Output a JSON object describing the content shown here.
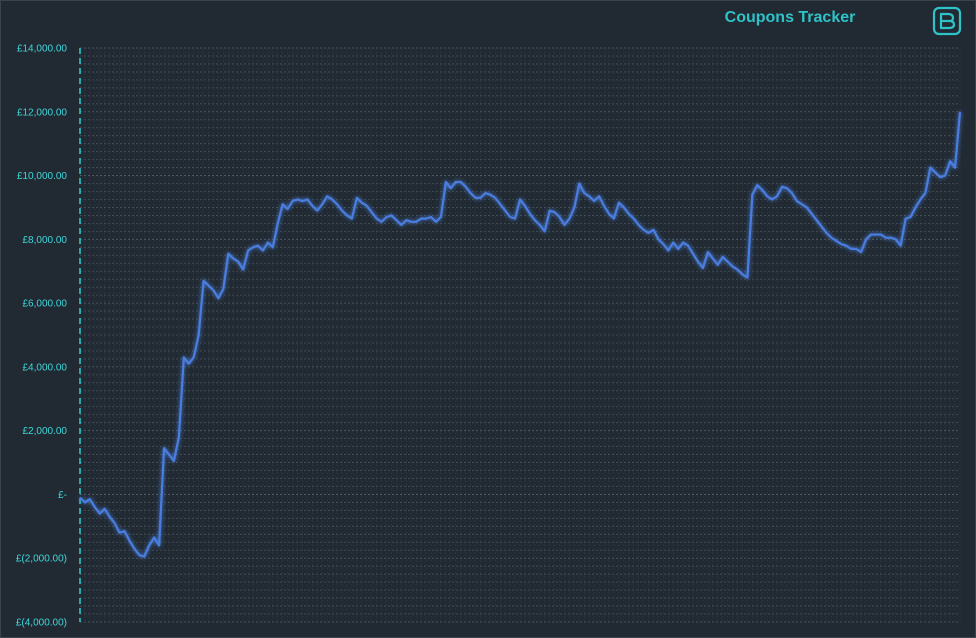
{
  "app": {
    "title": "Coupons Tracker",
    "logo_icon": "b-logo-icon",
    "accent_color": "#2ec3c9",
    "line_color": "#4a7ee0",
    "background_color": "#212a32"
  },
  "chart_data": {
    "type": "line",
    "title": "Coupons Tracker",
    "xlabel": "",
    "ylabel": "",
    "ylim": [
      -4000,
      14000
    ],
    "grid": true,
    "legend": "none",
    "y_ticks": [
      {
        "value": 14000,
        "label": "£14,000.00"
      },
      {
        "value": 12000,
        "label": "£12,000.00"
      },
      {
        "value": 10000,
        "label": "£10,000.00"
      },
      {
        "value": 8000,
        "label": "£8,000.00"
      },
      {
        "value": 6000,
        "label": "£6,000.00"
      },
      {
        "value": 4000,
        "label": "£4,000.00"
      },
      {
        "value": 2000,
        "label": "£2,000.00"
      },
      {
        "value": 0,
        "label": "£-"
      },
      {
        "value": -2000,
        "label": "£(2,000.00)"
      },
      {
        "value": -4000,
        "label": "£(4,000.00)"
      }
    ],
    "series": [
      {
        "values": [
          -100,
          -250,
          -150,
          -400,
          -600,
          -450,
          -700,
          -900,
          -1200,
          -1150,
          -1450,
          -1700,
          -1900,
          -1950,
          -1600,
          -1350,
          -1600,
          1450,
          1250,
          1050,
          1800,
          4300,
          4100,
          4300,
          5000,
          6700,
          6550,
          6400,
          6150,
          6450,
          7550,
          7400,
          7300,
          7050,
          7650,
          7750,
          7800,
          7650,
          7900,
          7750,
          8500,
          9100,
          8950,
          9200,
          9250,
          9200,
          9250,
          9050,
          8900,
          9100,
          9350,
          9250,
          9100,
          8900,
          8750,
          8650,
          9300,
          9150,
          9050,
          8850,
          8650,
          8550,
          8700,
          8750,
          8600,
          8450,
          8600,
          8550,
          8550,
          8650,
          8650,
          8700,
          8550,
          8700,
          9800,
          9600,
          9800,
          9800,
          9650,
          9450,
          9300,
          9300,
          9450,
          9400,
          9300,
          9100,
          8900,
          8700,
          8650,
          9250,
          9050,
          8800,
          8600,
          8450,
          8250,
          8900,
          8850,
          8700,
          8450,
          8650,
          9000,
          9750,
          9450,
          9350,
          9200,
          9350,
          9050,
          8800,
          8650,
          9150,
          9000,
          8800,
          8650,
          8450,
          8300,
          8200,
          8300,
          8000,
          7850,
          7650,
          7900,
          7700,
          7900,
          7800,
          7550,
          7300,
          7100,
          7600,
          7400,
          7200,
          7450,
          7300,
          7150,
          7050,
          6900,
          6800,
          9400,
          9700,
          9550,
          9350,
          9250,
          9350,
          9650,
          9600,
          9450,
          9200,
          9100,
          9000,
          8800,
          8600,
          8400,
          8200,
          8050,
          7950,
          7850,
          7800,
          7700,
          7700,
          7600,
          8000,
          8150,
          8150,
          8150,
          8050,
          8050,
          8000,
          7800,
          8650,
          8700,
          9000,
          9250,
          9450,
          10250,
          10100,
          9950,
          10000,
          10450,
          10250,
          12000
        ]
      }
    ]
  }
}
